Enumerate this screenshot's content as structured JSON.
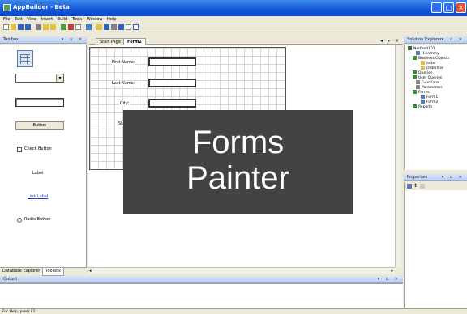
{
  "window": {
    "title": "AppBuilder - Beta"
  },
  "menu": [
    "File",
    "Edit",
    "View",
    "Insert",
    "Build",
    "Tools",
    "Window",
    "Help"
  ],
  "toolbox": {
    "header": "Toolbox",
    "items": {
      "button": "Button",
      "check": "Check Button",
      "label": "Label",
      "link": "Link Label",
      "radio": "Radio Button"
    },
    "bottom_tabs": [
      "Database Explorer",
      "Toolbox"
    ]
  },
  "editor": {
    "tabs": [
      "Start Page",
      "Form2"
    ],
    "fields": [
      "First Name:",
      "Last Name:",
      "City:",
      "State:"
    ]
  },
  "solution_explorer": {
    "header": "Solution Explorer",
    "tree": [
      "Nerfeed101",
      "Hierarchy",
      "Business Objects",
      "order",
      "Orderline",
      "Queries",
      "User Queries",
      "Functions",
      "Parameters",
      "Forms",
      "Form1",
      "Form2",
      "Reports"
    ]
  },
  "properties": {
    "header": "Properties"
  },
  "output": {
    "header": "Output"
  },
  "status": {
    "text": "For Help, press F1"
  },
  "overlay": {
    "line1": "Forms",
    "line2": "Painter"
  }
}
